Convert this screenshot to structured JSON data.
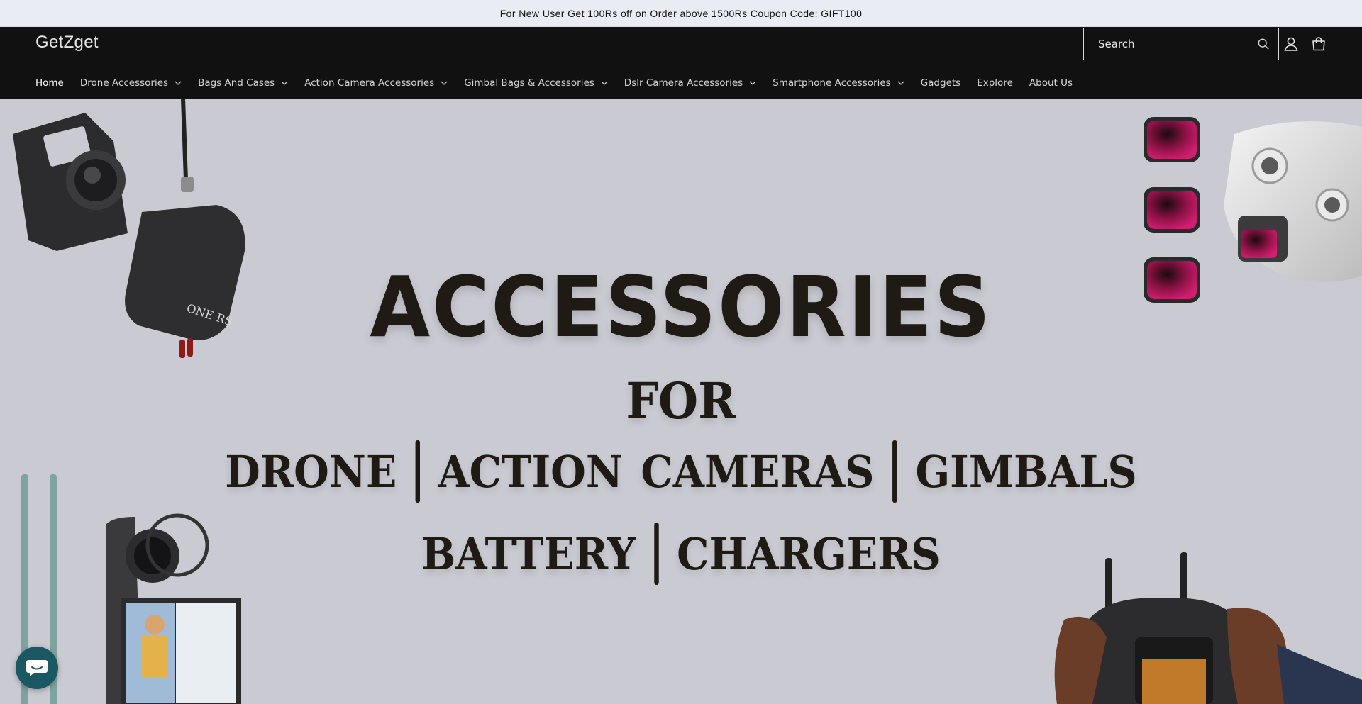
{
  "announcement": "For New User Get 100Rs off on Order above 1500Rs Coupon Code: GIFT100",
  "header": {
    "logo": "GetZget",
    "search_placeholder": "Search",
    "icons": [
      "search-icon",
      "account-icon",
      "cart-icon"
    ]
  },
  "nav": [
    {
      "label": "Home",
      "active": true,
      "dropdown": false
    },
    {
      "label": "Drone Accessories",
      "dropdown": true
    },
    {
      "label": "Bags And Cases",
      "dropdown": true
    },
    {
      "label": "Action Camera Accessories",
      "dropdown": true
    },
    {
      "label": "Gimbal Bags & Accessories",
      "dropdown": true
    },
    {
      "label": "Dslr Camera Accessories",
      "dropdown": true
    },
    {
      "label": "Smartphone Accessories",
      "dropdown": true
    },
    {
      "label": "Gadgets",
      "dropdown": false
    },
    {
      "label": "Explore",
      "dropdown": false
    },
    {
      "label": "About Us",
      "dropdown": false
    }
  ],
  "hero": {
    "line1": "ACCESSORIES",
    "line2": "FOR",
    "line3": [
      "DRONE",
      "ACTION CAMERAS",
      "GIMBALS"
    ],
    "line4": [
      "BATTERY",
      "CHARGERS"
    ]
  },
  "colors": {
    "announcement_bg": "#e9edf3",
    "header_bg": "#111111",
    "hero_bg": "#cacad2",
    "hero_text": "#1f1a14",
    "chat_button": "#1a5963",
    "nd_filter": "#c21c66"
  }
}
